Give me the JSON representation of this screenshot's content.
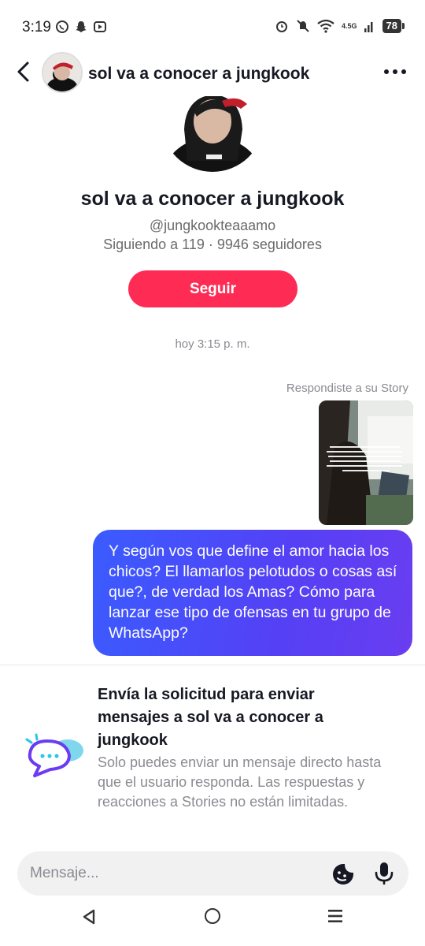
{
  "status_bar": {
    "time": "3:19",
    "left_icons": [
      "whatsapp-icon",
      "snapchat-icon",
      "youtube-icon"
    ],
    "right_icons": [
      "alarm-icon",
      "mute-icon",
      "wifi-icon",
      "signal-icon"
    ],
    "network": "4.5G",
    "battery": "78"
  },
  "header": {
    "title": "sol va a conocer a jungkook",
    "back_icon": "chevron-left-icon",
    "more_icon": "more-horizontal-icon"
  },
  "profile": {
    "name": "sol va a conocer a jungkook",
    "handle": "@jungkookteaaamo",
    "stats": "Siguiendo a 119 · 9946 seguidores",
    "follow_label": "Seguir"
  },
  "conversation": {
    "timestamp": "hoy 3:15 p. m.",
    "replied_label": "Respondiste a su Story",
    "message": "Y según vos que define el amor hacia los chicos? El llamarlos pelotudos o cosas así que?, de verdad los Amas? Cómo para lanzar ese tipo de ofensas en tu grupo de WhatsApp?"
  },
  "request": {
    "title": "Envía la solicitud para enviar mensajes a sol va a conocer a jungkook",
    "body": "Solo puedes enviar un mensaje directo hasta que el usuario responda. Las respuestas y reacciones a Stories no están limitadas."
  },
  "composer": {
    "placeholder": "Mensaje..."
  },
  "colors": {
    "accent": "#fe2c55",
    "bubble_start": "#3a5cff",
    "bubble_end": "#6a3df0",
    "muted_text": "#8a8b91"
  }
}
